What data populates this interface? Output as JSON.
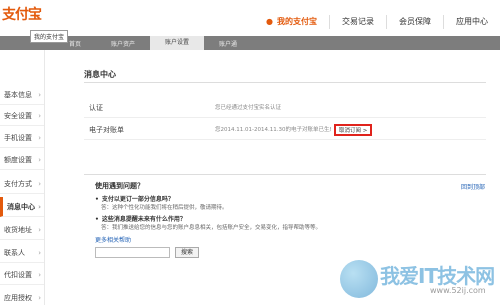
{
  "header": {
    "logo": "支付宝",
    "tooltip": "我的支付宝",
    "nav": [
      {
        "label": "我的支付宝",
        "active": true
      },
      {
        "label": "交易记录",
        "active": false
      },
      {
        "label": "会员保障",
        "active": false
      },
      {
        "label": "应用中心",
        "active": false
      }
    ],
    "nav_dot": "●"
  },
  "subnav": {
    "items": [
      {
        "label": "首页",
        "active": false
      },
      {
        "label": "账户资产",
        "active": false
      },
      {
        "label": "账户设置",
        "active": true
      },
      {
        "label": "账户通",
        "active": false
      }
    ]
  },
  "sidebar": {
    "items": [
      {
        "label": "基本信息"
      },
      {
        "label": "安全设置"
      },
      {
        "label": "手机设置"
      },
      {
        "label": "额度设置"
      },
      {
        "label": "支付方式"
      },
      {
        "label": "消息中心"
      },
      {
        "label": "收货地址"
      },
      {
        "label": "联系人"
      },
      {
        "label": "代扣设置"
      },
      {
        "label": "应用授权"
      }
    ],
    "active_index": 5,
    "chevron": "›"
  },
  "main": {
    "title": "消息中心",
    "rows": [
      {
        "label": "认证",
        "value": "您已经通过支付宝实名认证"
      },
      {
        "label": "电子对账单",
        "value": "您2014.11.01-2014.11.30的电子对账单已生成",
        "link": "取消订阅 >"
      }
    ],
    "help": {
      "title": "使用遇到问题？",
      "back_link": "回到顶部",
      "faqs": [
        {
          "q": "支付以更订一部分信息吗？",
          "a": "答：这种个性化功能我们将在稍后提供，敬请期待。"
        },
        {
          "q": "这些消息提醒未来有什么作用？",
          "a": "答：我们推送给您的信息与您的账户息息相关，包括账户安全，交易变化，指导帮助等等。"
        }
      ],
      "bullet": "•",
      "more_link": "更多相关帮助",
      "search_placeholder": "",
      "search_button": "搜索"
    }
  },
  "watermark": {
    "text": "我爱IT技术网",
    "url": "www.52ij.com"
  },
  "colors": {
    "brand": "#e35a0d",
    "highlight_box": "#e0231c",
    "link": "#2161b5",
    "subnav_bg": "#7d7d7d"
  }
}
